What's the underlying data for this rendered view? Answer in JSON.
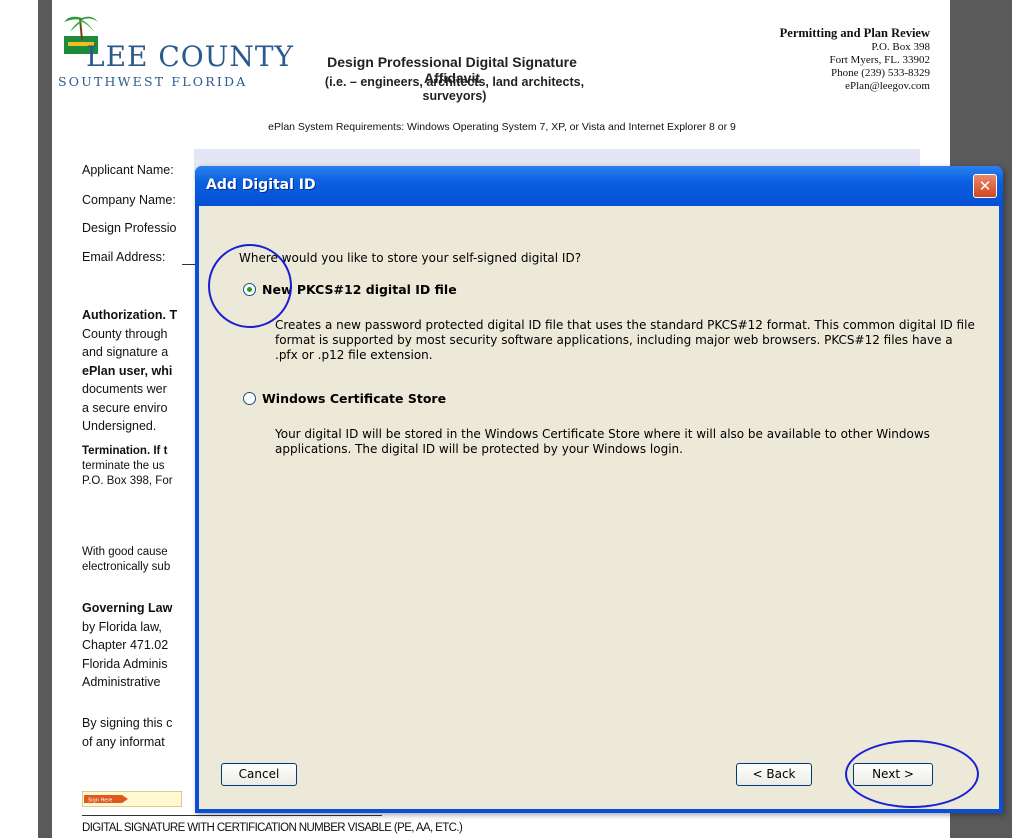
{
  "document": {
    "logo_title": "LEE COUNTY",
    "logo_subtitle": "SOUTHWEST FLORIDA",
    "title": "Design Professional Digital Signature Affidavit",
    "subtitle": "(i.e. – engineers, architects, land architects, surveyors)",
    "office": {
      "title": "Permitting and Plan Review",
      "lines": [
        "P.O. Box 398",
        "Fort Myers, FL. 33902",
        "Phone (239) 533-8329",
        "ePlan@leegov.com"
      ]
    },
    "requirements": "ePlan System Requirements: Windows Operating System 7, XP, or Vista and Internet Explorer 8 or 9",
    "form_labels": [
      "Applicant Name:",
      "Company Name:",
      "Design Professio",
      "Email Address:"
    ],
    "paragraphs": [
      [
        "Authorization. T",
        "County through",
        "and signature a",
        "ePlan user, whi",
        "documents wer",
        "a secure enviro",
        "Undersigned."
      ],
      [
        "Termination. If t",
        "terminate the us",
        "P.O. Box 398, For"
      ],
      [
        "With good cause",
        "electronically sub"
      ],
      [
        "Governing Law",
        "by Florida law, ",
        "Chapter 471.02",
        "Florida Adminis",
        "Administrative "
      ],
      [
        "By signing this c",
        "of any informat"
      ]
    ],
    "signature_caption": "DIGITAL SIGNATURE WITH CERTIFICATION NUMBER VISABLE (PE, AA, ETC.)",
    "sign_here_label": "Sign Here"
  },
  "dialog": {
    "title": "Add Digital ID",
    "close_label": "✕",
    "question": "Where would you like to store your self-signed digital ID?",
    "options": [
      {
        "label": "New PKCS#12 digital ID file",
        "checked": true,
        "description": "Creates a new password protected digital ID file that uses the standard PKCS#12 format. This common digital ID file format is supported by most security software applications, including major web browsers. PKCS#12 files have a .pfx or .p12 file extension."
      },
      {
        "label": "Windows Certificate Store",
        "checked": false,
        "description": "Your digital ID will be stored in the Windows Certificate Store where it will also be available to other Windows applications. The digital ID will be protected by your Windows login."
      }
    ],
    "buttons": {
      "cancel": "Cancel",
      "back": "< Back",
      "next": "Next >"
    }
  },
  "colors": {
    "titlebar": "#0a5fe0",
    "dialog_face": "#ece9d8",
    "annotation": "#1a1fd6",
    "logo": "#2a5a8e",
    "radio_dot": "#21a121"
  }
}
